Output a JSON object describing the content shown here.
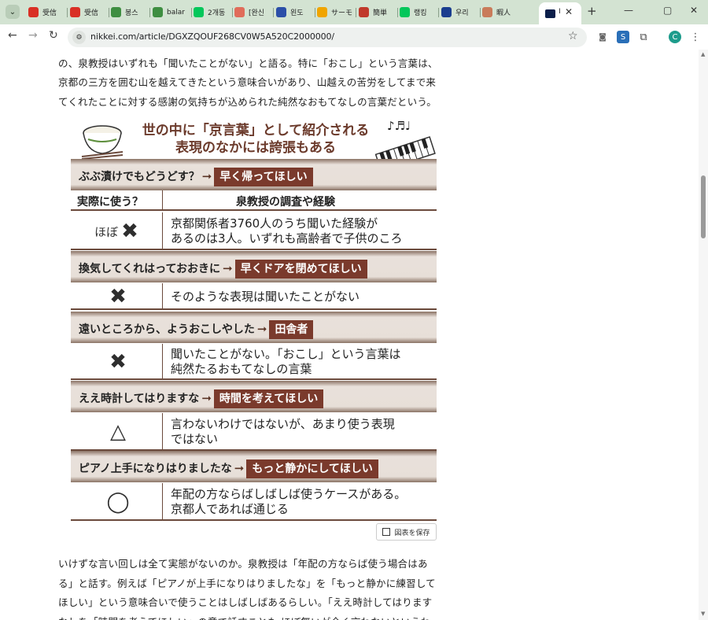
{
  "browser": {
    "tabs": [
      {
        "label": "受信",
        "icon": "gmail-icon",
        "color": "#d93025"
      },
      {
        "label": "受信",
        "icon": "gmail-icon",
        "color": "#d93025"
      },
      {
        "label": "봉스",
        "icon": "t-icon",
        "color": "#3e8e41"
      },
      {
        "label": "balar",
        "icon": "t-icon",
        "color": "#3e8e41"
      },
      {
        "label": "2개동",
        "icon": "naver-icon",
        "color": "#03c75a"
      },
      {
        "label": "[완신",
        "icon": "t-circle-icon",
        "color": "#e06c5a"
      },
      {
        "label": "왼도",
        "icon": "shield-icon",
        "color": "#2b4fa8"
      },
      {
        "label": "サーモ",
        "icon": "r-icon",
        "color": "#f0a500"
      },
      {
        "label": "簡単",
        "icon": "g-icon",
        "color": "#c0392b"
      },
      {
        "label": "랭킹",
        "icon": "n-icon",
        "color": "#03c75a"
      },
      {
        "label": "우리",
        "icon": "cube-icon",
        "color": "#1a3d8f"
      },
      {
        "label": "暇人",
        "icon": "face-icon",
        "color": "#c97b5a"
      }
    ],
    "active_tab_label": "I",
    "url": "nikkei.com/article/DGXZQOUF268CV0W5A520C2000000/",
    "window_buttons": [
      "⌄",
      "—",
      "▢",
      "✕"
    ]
  },
  "article": {
    "para1": [
      "の、泉教授はいずれも「聞いたことがない」と語る。特に「おこし」という言葉は、",
      "京都の三方を囲む山を越えてきたという意味合いがあり、山越えの苦労をしてまで来",
      "てくれたことに対する感謝の気持ちが込められた純然なおもてなしの言葉だという。"
    ],
    "para2": [
      "いけずな言い回しは全て実態がないのか。泉教授は「年配の方ならば使う場合はあ",
      "る」と話す。例えば「ピアノが上手になりはりましたな」を「もっと静かに練習して",
      "ほしい」という意味合いで使うことはしばしばあるらしい。「ええ時計してはります",
      "なしを「時間を考えてほしい」の意で話すことも ほぼ無いが全く言わないというわ"
    ],
    "save_label": "図表を保存"
  },
  "figure": {
    "title_line1": "世の中に「京言葉」として紹介される",
    "title_line2": "表現のなかには誇張もある",
    "music_notes": "♪♬♩",
    "header_left": "実際に使う？",
    "header_right": "泉教授の調査や経験",
    "items": [
      {
        "phrase": "ぶぶ漬けでもどうどす？",
        "meaning": "早く帰ってほしい",
        "usage_prefix": "ほぼ",
        "usage_symbol": "✖",
        "comment_lines": [
          "京都関係者3760人のうち聞いた経験が",
          "あるのは3人。いずれも高齢者で子供のころ"
        ]
      },
      {
        "phrase": "換気してくれはっておおきに",
        "meaning": "早くドアを閉めてほしい",
        "usage_prefix": "",
        "usage_symbol": "✖",
        "comment_lines": [
          "そのような表現は聞いたことがない"
        ]
      },
      {
        "phrase": "遠いところから、ようおこしやした",
        "meaning": "田舎者",
        "usage_prefix": "",
        "usage_symbol": "✖",
        "comment_lines": [
          "聞いたことがない。「おこし」という言葉は",
          "純然たるおもてなしの言葉"
        ]
      },
      {
        "phrase": "ええ時計してはりますな",
        "meaning": "時間を考えてほしい",
        "usage_prefix": "",
        "usage_symbol": "△",
        "comment_lines": [
          "言わないわけではないが、あまり使う表現",
          "ではない"
        ]
      },
      {
        "phrase": "ピアノ上手になりはりましたな",
        "meaning": "もっと静かにしてほしい",
        "usage_prefix": "",
        "usage_symbol": "◯",
        "comment_lines": [
          "年配の方ならばしばしば使うケースがある。",
          "京都人であれば通じる"
        ]
      }
    ]
  }
}
